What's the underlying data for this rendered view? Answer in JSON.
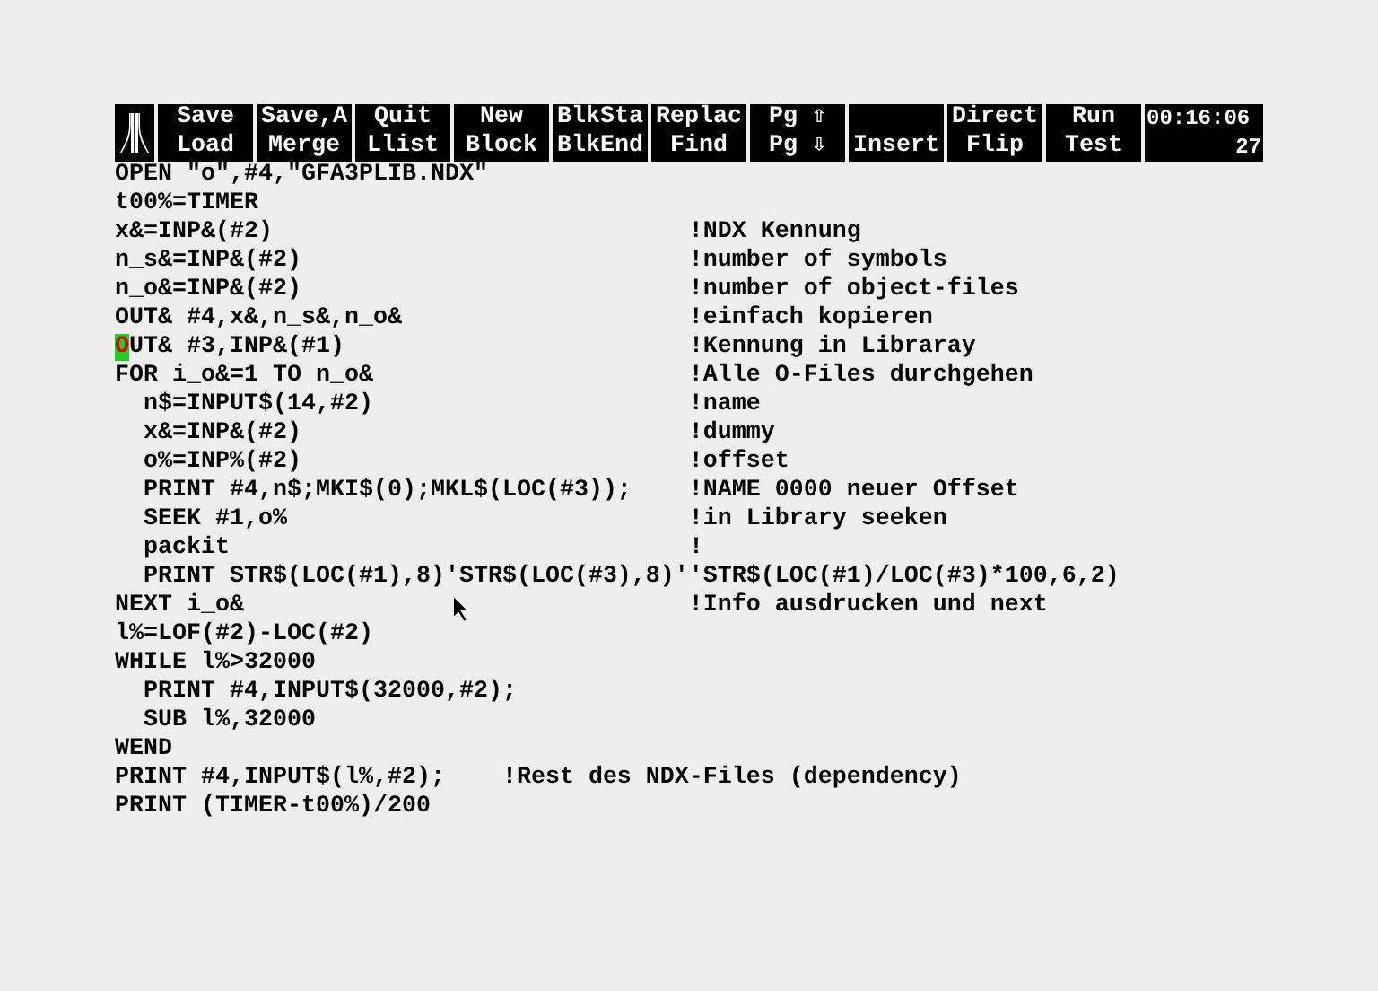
{
  "menu_bar": {
    "items": [
      {
        "top": "Save",
        "bottom": "Load"
      },
      {
        "top": "Save,A",
        "bottom": "Merge"
      },
      {
        "top": "Quit",
        "bottom": "Llist"
      },
      {
        "top": "New",
        "bottom": "Block"
      },
      {
        "top": "BlkSta",
        "bottom": "BlkEnd"
      },
      {
        "top": "Replac",
        "bottom": "Find"
      },
      {
        "top": "Pg ⇧",
        "bottom": "Pg ⇩"
      },
      {
        "bottom": "Insert"
      },
      {
        "top": "Direct",
        "bottom": "Flip"
      },
      {
        "top": "Run",
        "bottom": "Test"
      }
    ],
    "clock": {
      "time": "00:16:06",
      "line": "27"
    }
  },
  "editor": {
    "lines": [
      {
        "code": "OPEN \"o\",#4,\"GFA3PLIB.NDX\"",
        "cursor": false
      },
      {
        "code": "t00%=TIMER",
        "cursor": false
      },
      {
        "code": "x&=INP&(#2)",
        "comment": "!NDX Kennung",
        "cursor": false
      },
      {
        "code": "n_s&=INP&(#2)",
        "comment": "!number of symbols",
        "cursor": false
      },
      {
        "code": "n_o&=INP&(#2)",
        "comment": "!number of object-files",
        "cursor": false
      },
      {
        "code": "OUT& #4,x&,n_s&,n_o&",
        "comment": "!einfach kopieren",
        "cursor": false
      },
      {
        "code": "OUT& #3,INP&(#1)",
        "comment": "!Kennung in Libraray",
        "cursor": true
      },
      {
        "code": "FOR i_o&=1 TO n_o&",
        "comment": "!Alle O-Files durchgehen",
        "cursor": false
      },
      {
        "code": "  n$=INPUT$(14,#2)",
        "comment": "!name",
        "cursor": false
      },
      {
        "code": "  x&=INP&(#2)",
        "comment": "!dummy",
        "cursor": false
      },
      {
        "code": "  o%=INP%(#2)",
        "comment": "!offset",
        "cursor": false
      },
      {
        "code": "  PRINT #4,n$;MKI$(0);MKL$(LOC(#3));",
        "comment": "!NAME 0000 neuer Offset",
        "cursor": false
      },
      {
        "code": "  SEEK #1,o%",
        "comment": "!in Library seeken",
        "cursor": false
      },
      {
        "code": "  packit",
        "comment": "!",
        "cursor": false
      },
      {
        "code": "  PRINT STR$(LOC(#1),8)'STR$(LOC(#3),8)''STR$(LOC(#1)/LOC(#3)*100,6,2)",
        "cursor": false
      },
      {
        "code": "NEXT i_o&",
        "comment": "!Info ausdrucken und next",
        "cursor": false
      },
      {
        "code": "l%=LOF(#2)-LOC(#2)",
        "cursor": false
      },
      {
        "code": "WHILE l%>32000",
        "cursor": false
      },
      {
        "code": "  PRINT #4,INPUT$(32000,#2);",
        "cursor": false
      },
      {
        "code": "  SUB l%,32000",
        "cursor": false
      },
      {
        "code": "WEND",
        "cursor": false
      },
      {
        "code": "PRINT #4,INPUT$(l%,#2);    !Rest des NDX-Files (dependency)",
        "cursor": false
      },
      {
        "code": "PRINT (TIMER-t00%)/200",
        "cursor": false
      }
    ]
  }
}
